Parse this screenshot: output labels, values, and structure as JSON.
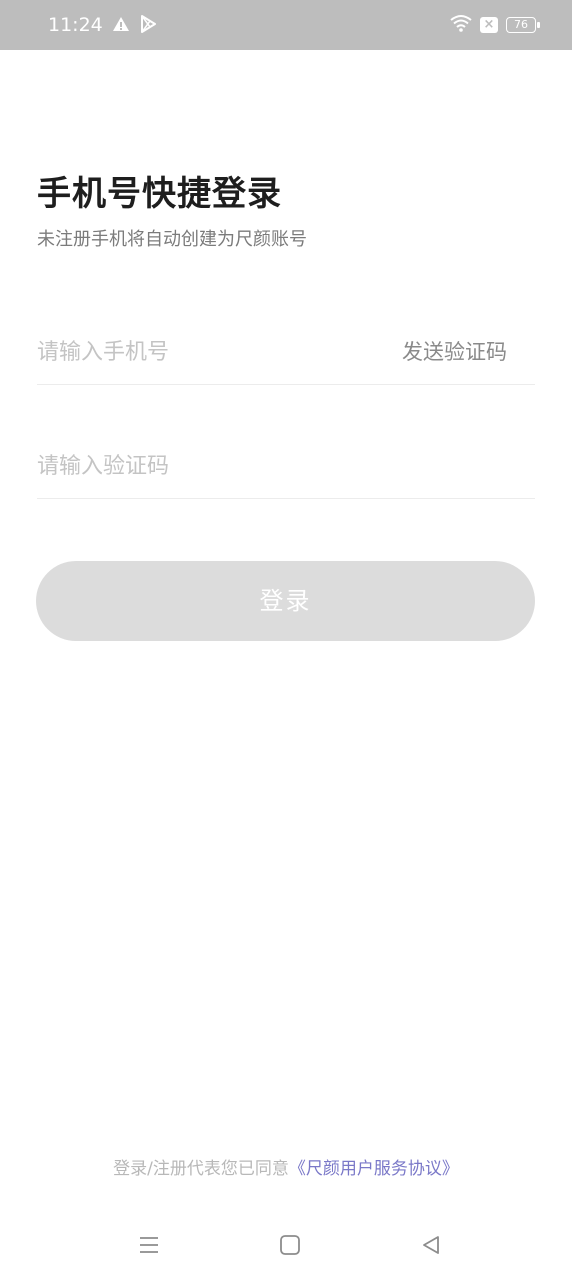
{
  "status_bar": {
    "time": "11:24",
    "battery": "76",
    "icons": [
      "warning-icon",
      "play-store-icon",
      "wifi-icon",
      "close-box-icon",
      "battery-icon"
    ]
  },
  "header": {
    "title": "手机号快捷登录",
    "subtitle": "未注册手机将自动创建为尺颜账号"
  },
  "form": {
    "phone_placeholder": "请输入手机号",
    "send_code_label": "发送验证码",
    "code_placeholder": "请输入验证码",
    "login_label": "登录"
  },
  "agreement": {
    "prefix": "登录/注册代表您已同意",
    "link": "《尺颜用户服务协议》"
  },
  "nav_bar": {
    "icons": [
      "menu-icon",
      "home-icon",
      "back-icon"
    ]
  },
  "colors": {
    "status_bar_bg": "#bdbdbd",
    "button_disabled_bg": "#dcdcdc",
    "link_color": "#7a78c8"
  }
}
